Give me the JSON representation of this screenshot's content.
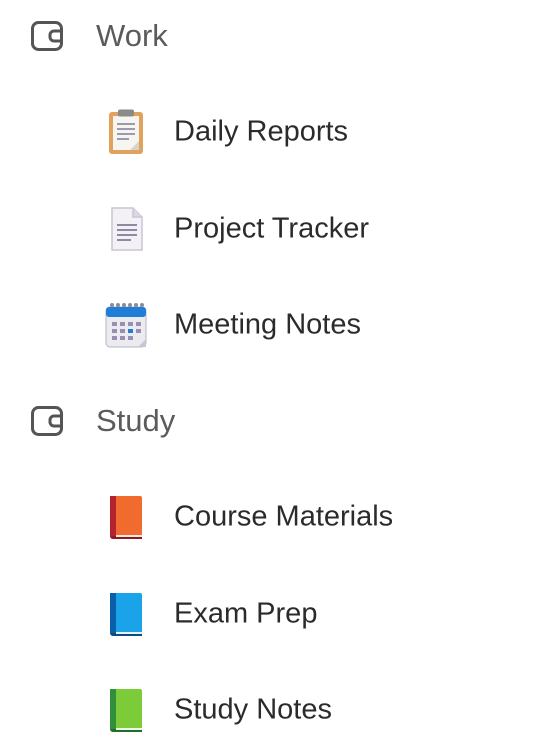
{
  "groups": [
    {
      "label": "Work",
      "icon": "notebook-icon",
      "pages": [
        {
          "label": "Daily Reports",
          "icon": "clipboard-icon"
        },
        {
          "label": "Project Tracker",
          "icon": "document-icon"
        },
        {
          "label": "Meeting Notes",
          "icon": "calendar-icon"
        }
      ]
    },
    {
      "label": "Study",
      "icon": "notebook-icon",
      "pages": [
        {
          "label": "Course Materials",
          "icon": "orange-book-icon",
          "color": "#f26b2e"
        },
        {
          "label": "Exam Prep",
          "icon": "blue-book-icon",
          "color": "#1aa3e8"
        },
        {
          "label": "Study Notes",
          "icon": "green-book-icon",
          "color": "#7ccc3a"
        }
      ]
    }
  ]
}
